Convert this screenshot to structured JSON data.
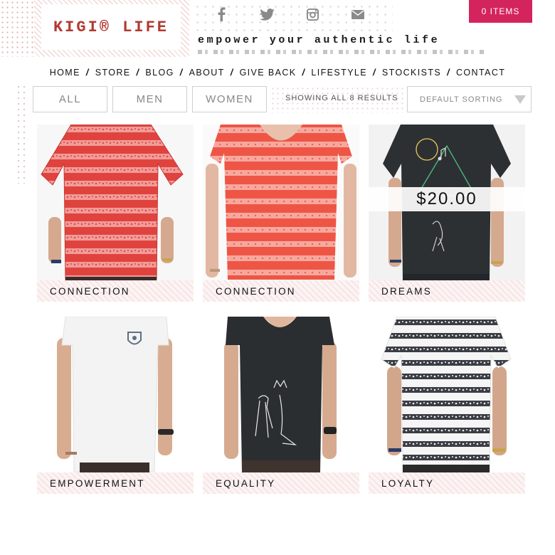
{
  "brand": {
    "logo": "KIGI® LIFE",
    "tagline": "empower your authentic life"
  },
  "social": [
    "facebook-icon",
    "twitter-icon",
    "instagram-icon",
    "mail-icon"
  ],
  "cart": {
    "label": "0 ITEMS"
  },
  "nav": [
    "HOME",
    "STORE",
    "BLOG",
    "ABOUT",
    "GIVE BACK",
    "LIFESTYLE",
    "STOCKISTS",
    "CONTACT"
  ],
  "filters": {
    "all": "ALL",
    "men": "MEN",
    "women": "WOMEN"
  },
  "results": "SHOWING ALL 8 RESULTS",
  "sorting": {
    "selected": "DEFAULT SORTING"
  },
  "products": [
    {
      "name": "CONNECTION",
      "shirt_color": "#e0433e",
      "stripe": "#f1a3a0",
      "model": "men"
    },
    {
      "name": "CONNECTION",
      "shirt_color": "#ee5545",
      "stripe": "#f6aaa0",
      "model": "women"
    },
    {
      "name": "DREAMS",
      "shirt_color": "#2d3033",
      "price": "$20.00",
      "model": "men"
    },
    {
      "name": "EMPOWERMENT",
      "shirt_color": "#f3f3f3",
      "model": "women"
    },
    {
      "name": "EQUALITY",
      "shirt_color": "#2b2e31",
      "model": "women"
    },
    {
      "name": "LOYALTY",
      "shirt_color": "#f5f5f5",
      "stripe": "#3a3d44",
      "model": "men"
    }
  ],
  "colors": {
    "accent": "#d4245d",
    "logo": "#b03a32"
  }
}
